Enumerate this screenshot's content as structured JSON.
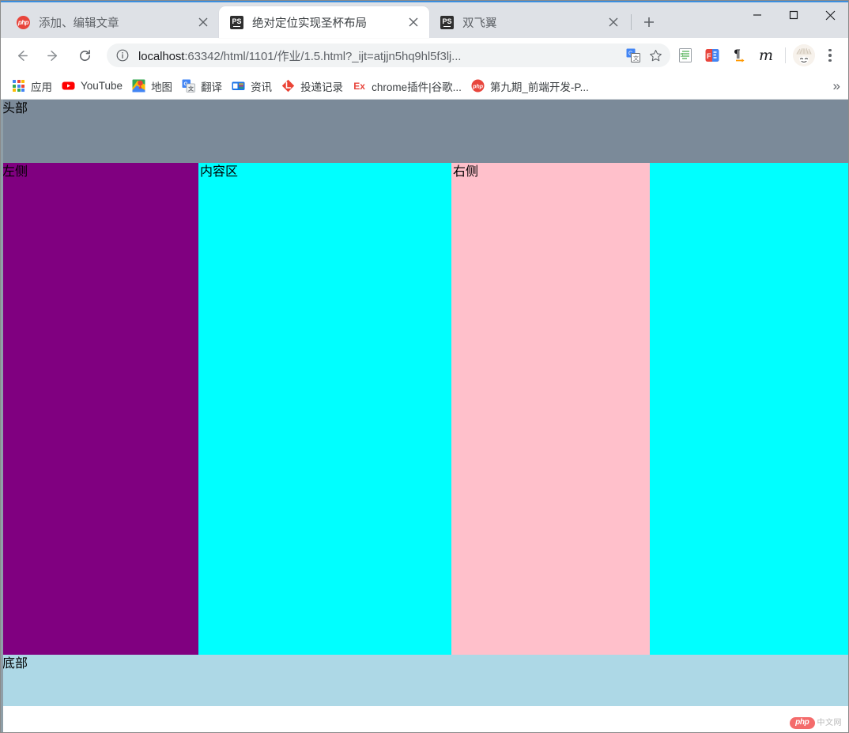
{
  "browser": {
    "tabs": [
      {
        "title": "添加、编辑文章",
        "favicon": "php-icon",
        "active": false
      },
      {
        "title": "绝对定位实现圣杯布局",
        "favicon": "photoshop-icon",
        "active": true
      },
      {
        "title": "双飞翼",
        "favicon": "photoshop-icon",
        "active": false
      }
    ],
    "new_tab_label": "+",
    "window_controls": {
      "minimize": "minimize-icon",
      "maximize": "maximize-icon",
      "close": "close-icon"
    },
    "toolbar": {
      "back": "back-arrow-icon",
      "forward": "forward-arrow-icon",
      "reload": "reload-icon",
      "site_info": "info-circle-icon",
      "url_host": "localhost",
      "url_rest": ":63342/html/1101/作业/1.5.html?_ijt=atjjn5hq9hl5f3lj...",
      "url_full": "localhost:63342/html/1101/作业/1.5.html?_ijt=atjjn5hq9hl5f3lj...",
      "translate": "google-translate-icon",
      "bookmark_star": "star-icon",
      "extensions": [
        "list-extension-icon",
        "fe-extension-icon",
        "pilcrow-extension-icon",
        "m-extension-icon"
      ],
      "profile": "avatar-icon",
      "menu": "three-dot-menu-icon"
    },
    "bookmarks": [
      {
        "label": "应用",
        "icon": "apps-grid-icon"
      },
      {
        "label": "YouTube",
        "icon": "youtube-icon"
      },
      {
        "label": "地图",
        "icon": "google-maps-icon"
      },
      {
        "label": "翻译",
        "icon": "google-translate-icon"
      },
      {
        "label": "资讯",
        "icon": "google-news-icon"
      },
      {
        "label": "投递记录",
        "icon": "lagou-icon"
      },
      {
        "label": "chrome插件|谷歌...",
        "icon": "ex-icon"
      },
      {
        "label": "第九期_前端开发-P...",
        "icon": "php-icon"
      }
    ],
    "bookmarks_overflow": "»"
  },
  "page": {
    "header": {
      "label": "头部",
      "color": "#7b8a99"
    },
    "left": {
      "label": "左侧",
      "color": "#800080"
    },
    "content": {
      "label": "内容区",
      "color": "#00ffff"
    },
    "right": {
      "label": "右侧",
      "color": "#ffc0cb"
    },
    "footer": {
      "label": "底部",
      "color": "#add8e6"
    },
    "watermark": {
      "brand": "php",
      "suffix": "中文网"
    }
  }
}
